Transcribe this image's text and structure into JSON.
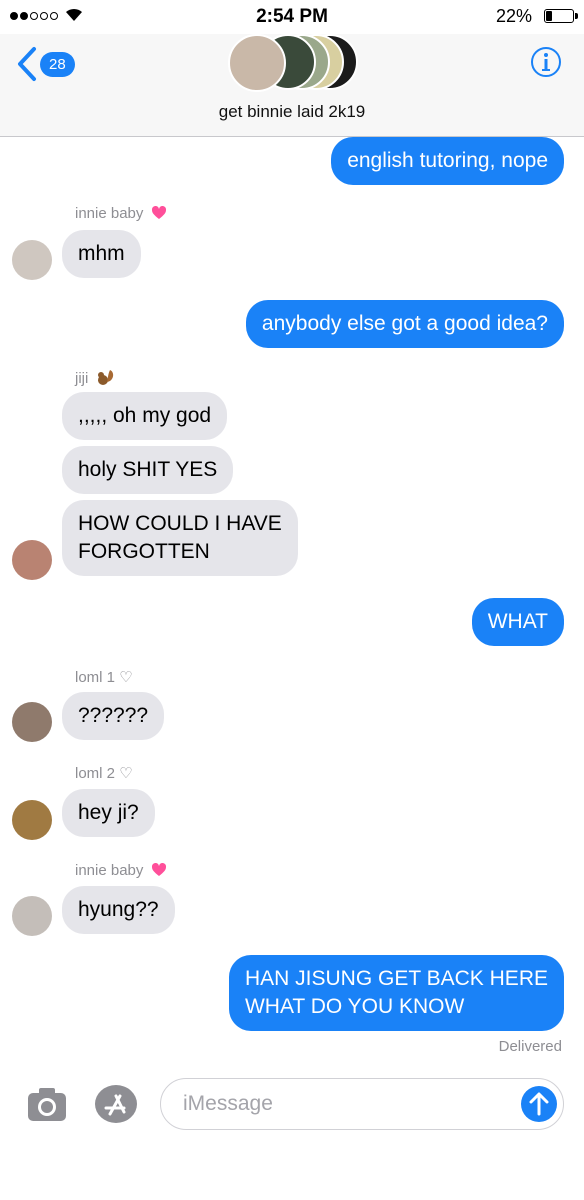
{
  "status_bar": {
    "time": "2:54 PM",
    "battery_percent": "22%",
    "battery_level": 0.22,
    "signal_bars": 2
  },
  "header": {
    "back_badge": "28",
    "group_name": "get binnie laid 2k19"
  },
  "messages": [
    {
      "text": "english tutoring, nope"
    },
    {
      "sender": "innie baby",
      "sender_icon": "pink-heart-icon"
    },
    {
      "text": "mhm"
    },
    {
      "text": "anybody else got a good idea?"
    },
    {
      "sender": "jiji",
      "sender_icon": "squirrel-icon"
    },
    {
      "text": ",,,,, oh my god"
    },
    {
      "text": "holy SHIT YES"
    },
    {
      "line1": "HOW COULD I HAVE",
      "line2": "FORGOTTEN"
    },
    {
      "text": "WHAT"
    },
    {
      "sender": "loml 1 ♡"
    },
    {
      "text": "??????"
    },
    {
      "sender": "loml 2 ♡"
    },
    {
      "text": "hey ji?"
    },
    {
      "sender": "innie baby",
      "sender_icon": "pink-heart-icon"
    },
    {
      "text": "hyung??"
    },
    {
      "line1": "HAN JISUNG GET BACK HERE",
      "line2": "WHAT DO YOU KNOW"
    },
    {
      "text": "Delivered"
    }
  ],
  "input": {
    "placeholder": "iMessage"
  },
  "colors": {
    "outgoing": "#1a82f7",
    "incoming": "#e5e5ea",
    "heart": "#ff4f9a"
  }
}
